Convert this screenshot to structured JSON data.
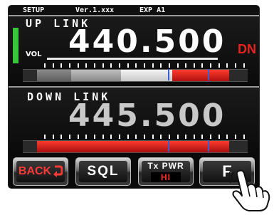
{
  "status_bar": {
    "mode": "SETUP",
    "version": "Ver.1.xxx",
    "region": "EXP A1"
  },
  "uplink": {
    "label": "UP LINK",
    "frequency": "440.500",
    "vol_label": "VOL",
    "shift": "DN",
    "meter_level": 0.72
  },
  "downlink": {
    "label": "DOWN LINK",
    "frequency": "445.500",
    "meter_level": 0.95
  },
  "buttons": {
    "back": "BACK",
    "sql": "SQL",
    "txpwr": "Tx PWR",
    "txpwr_value": "HI",
    "f": "F"
  },
  "colors": {
    "accent_red": "#e8231f",
    "green_indicator": "#39c43a",
    "meter_blue": "#3a5dd6"
  },
  "icons": {
    "back_arrow": "return-arrow-icon",
    "hand": "pointing-hand-icon"
  }
}
